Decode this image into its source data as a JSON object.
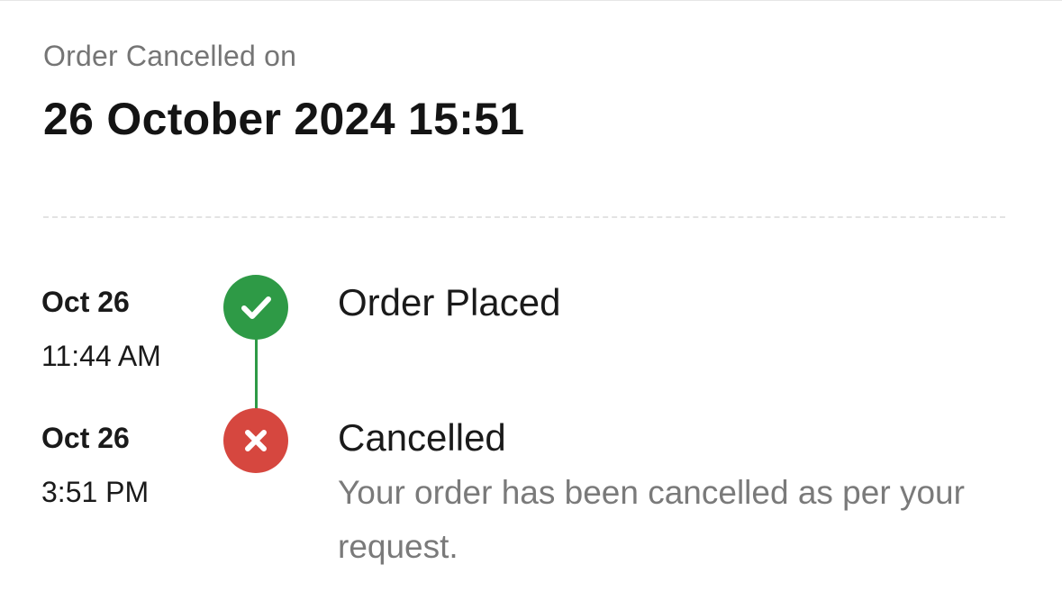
{
  "header": {
    "label": "Order Cancelled on",
    "date": "26 October 2024 15:51"
  },
  "timeline": [
    {
      "date": "Oct 26",
      "time": "11:44 AM",
      "title": "Order Placed",
      "status": "success",
      "icon": "check-icon",
      "color": "#2e9a46"
    },
    {
      "date": "Oct 26",
      "time": "3:51 PM",
      "title": "Cancelled",
      "description": "Your order has been cancelled as per your request.",
      "status": "cancelled",
      "icon": "close-icon",
      "color": "#d6473f"
    }
  ]
}
